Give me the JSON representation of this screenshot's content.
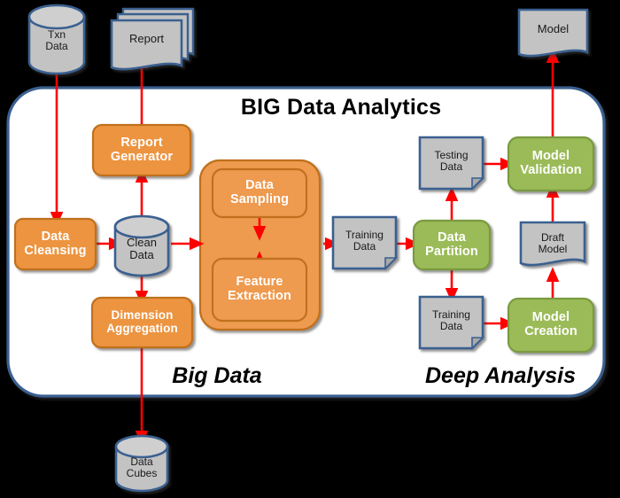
{
  "diagram": {
    "title": "BIG Data Analytics",
    "sections": [
      {
        "id": "big-data",
        "label": "Big Data"
      },
      {
        "id": "deep-analysis",
        "label": "Deep Analysis"
      }
    ],
    "colors": {
      "process_orange_fill": "#ED9440",
      "process_orange_border": "#C0701F",
      "process_green_fill": "#9BBB59",
      "process_green_border": "#7A9A3F",
      "datastore_gray_fill": "#C3C3C3",
      "datastore_border": "#3B6190",
      "panel_fill": "#FFFFFF",
      "panel_border": "#3B6190",
      "arrow_red": "#FF0000",
      "background": "#000000",
      "group_box_fill": "#EE9A4F",
      "group_box_border": "#C0701F"
    },
    "nodes": [
      {
        "id": "txn-data",
        "label": "Txn Data",
        "line1": "Txn",
        "line2": "Data",
        "shape": "cylinder",
        "group": "external"
      },
      {
        "id": "report",
        "label": "Report",
        "line1": "Report",
        "line2": "",
        "shape": "document-stack",
        "group": "external"
      },
      {
        "id": "model",
        "label": "Model",
        "line1": "Model",
        "line2": "",
        "shape": "document-wave",
        "group": "external"
      },
      {
        "id": "data-cleansing",
        "label": "Data Cleansing",
        "line1": "Data",
        "line2": "Cleansing",
        "shape": "process",
        "group": "big-data"
      },
      {
        "id": "clean-data",
        "label": "Clean Data",
        "line1": "Clean",
        "line2": "Data",
        "shape": "cylinder",
        "group": "big-data"
      },
      {
        "id": "report-generator",
        "label": "Report Generator",
        "line1": "Report",
        "line2": "Generator",
        "shape": "process",
        "group": "big-data"
      },
      {
        "id": "dimension-aggregation",
        "label": "Dimension Aggregation",
        "line1": "Dimension",
        "line2": "Aggregation",
        "shape": "process",
        "group": "big-data"
      },
      {
        "id": "data-sampling",
        "label": "Data Sampling",
        "line1": "Data",
        "line2": "Sampling",
        "shape": "process",
        "group": "big-data"
      },
      {
        "id": "feature-extraction",
        "label": "Feature Extraction",
        "line1": "Feature",
        "line2": "Extraction",
        "shape": "process",
        "group": "big-data"
      },
      {
        "id": "training-data-in",
        "label": "Training Data",
        "line1": "Training",
        "line2": "Data",
        "shape": "document-fold",
        "group": "deep-analysis"
      },
      {
        "id": "data-partition",
        "label": "Data Partition",
        "line1": "Data",
        "line2": "Partition",
        "shape": "process",
        "group": "deep-analysis"
      },
      {
        "id": "testing-data",
        "label": "Testing Data",
        "line1": "Testing",
        "line2": "Data",
        "shape": "document-fold",
        "group": "deep-analysis"
      },
      {
        "id": "training-data-out",
        "label": "Training Data",
        "line1": "Training",
        "line2": "Data",
        "shape": "document-fold",
        "group": "deep-analysis"
      },
      {
        "id": "model-validation",
        "label": "Model Validation",
        "line1": "Model",
        "line2": "Validation",
        "shape": "process",
        "group": "deep-analysis"
      },
      {
        "id": "model-creation",
        "label": "Model Creation",
        "line1": "Model",
        "line2": "Creation",
        "shape": "process",
        "group": "deep-analysis"
      },
      {
        "id": "draft-model",
        "label": "Draft Model",
        "line1": "Draft",
        "line2": "Model",
        "shape": "document-wave",
        "group": "deep-analysis"
      },
      {
        "id": "data-cubes",
        "label": "Data Cubes",
        "line1": "Data",
        "line2": "Cubes",
        "shape": "cylinder",
        "group": "external"
      }
    ],
    "edges": [
      {
        "id": "e1",
        "from": "txn-data",
        "to": "data-cleansing",
        "direction": "one-way"
      },
      {
        "id": "e2",
        "from": "data-cleansing",
        "to": "clean-data",
        "direction": "one-way"
      },
      {
        "id": "e3",
        "from": "clean-data",
        "to": "report-generator",
        "direction": "one-way"
      },
      {
        "id": "e4",
        "from": "report-generator",
        "to": "report",
        "direction": "one-way"
      },
      {
        "id": "e5",
        "from": "clean-data",
        "to": "dimension-aggregation",
        "direction": "one-way"
      },
      {
        "id": "e6",
        "from": "dimension-aggregation",
        "to": "data-cubes",
        "direction": "one-way"
      },
      {
        "id": "e7",
        "from": "clean-data",
        "to": "data-sampling",
        "direction": "one-way"
      },
      {
        "id": "e8",
        "from": "data-sampling",
        "to": "feature-extraction",
        "direction": "two-way"
      },
      {
        "id": "e9",
        "from": "feature-extraction",
        "to": "training-data-in",
        "direction": "one-way"
      },
      {
        "id": "e10",
        "from": "training-data-in",
        "to": "data-partition",
        "direction": "one-way"
      },
      {
        "id": "e11",
        "from": "data-partition",
        "to": "testing-data",
        "direction": "one-way"
      },
      {
        "id": "e12",
        "from": "data-partition",
        "to": "training-data-out",
        "direction": "one-way"
      },
      {
        "id": "e13",
        "from": "testing-data",
        "to": "model-validation",
        "direction": "one-way"
      },
      {
        "id": "e14",
        "from": "training-data-out",
        "to": "model-creation",
        "direction": "one-way"
      },
      {
        "id": "e15",
        "from": "model-creation",
        "to": "draft-model",
        "direction": "one-way"
      },
      {
        "id": "e16",
        "from": "draft-model",
        "to": "model-validation",
        "direction": "one-way"
      },
      {
        "id": "e17",
        "from": "model-validation",
        "to": "model",
        "direction": "one-way"
      }
    ]
  }
}
